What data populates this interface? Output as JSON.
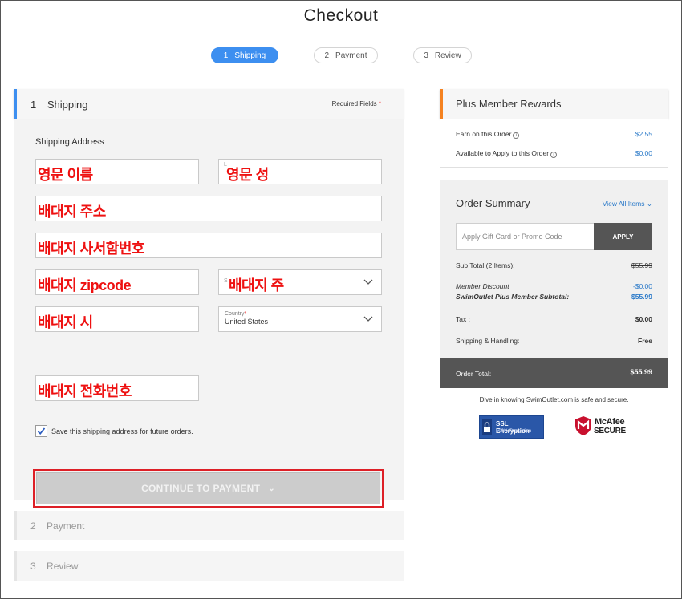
{
  "page": {
    "title": "Checkout"
  },
  "steps": [
    {
      "num": "1",
      "label": "Shipping",
      "active": true
    },
    {
      "num": "2",
      "label": "Payment",
      "active": false
    },
    {
      "num": "3",
      "label": "Review",
      "active": false
    }
  ],
  "shipping": {
    "num": "1",
    "title": "Shipping",
    "required_label": "Required Fields",
    "required_mark": "*",
    "address_label": "Shipping Address",
    "fields": {
      "first_name": "영문 이름",
      "last_name": "영문 성",
      "address": "배대지 주소",
      "address2": "배대지 사서함번호",
      "zipcode": "배대지 zipcode",
      "state": "배대지 주",
      "city": "배대지 시",
      "phone": "배대지 전화번호"
    },
    "country": {
      "label": "Country",
      "value": "United States"
    },
    "save_label": "Save this shipping address for future orders.",
    "save_checked": true,
    "continue_label": "CONTINUE TO PAYMENT"
  },
  "collapsed_sections": {
    "payment": {
      "num": "2",
      "title": "Payment"
    },
    "review": {
      "num": "3",
      "title": "Review"
    }
  },
  "rewards": {
    "title": "Plus Member Rewards",
    "earn_label": "Earn on this Order",
    "earn_value": "$2.55",
    "available_label": "Available to Apply to this Order",
    "available_value": "$0.00"
  },
  "summary": {
    "title": "Order Summary",
    "view_all": "View All Items",
    "promo_placeholder": "Apply Gift Card or Promo Code",
    "apply_label": "APPLY",
    "subtotal_label": "Sub Total (2 Items):",
    "subtotal_value": "$55.99",
    "discount_label": "Member Discount",
    "discount_value": "-$0.00",
    "member_subtotal_label": "SwimOutlet Plus Member Subtotal:",
    "member_subtotal_value": "$55.99",
    "tax_label": "Tax :",
    "tax_value": "$0.00",
    "shipping_label": "Shipping & Handling:",
    "shipping_value": "Free",
    "total_label": "Order Total:",
    "total_value": "$55.99"
  },
  "security": {
    "text": "Dive in knowing SwimOutlet.com is safe and secure.",
    "ssl_title": "SSL Encryption",
    "ssl_sub": "100% Protection",
    "mcafee_a": "McAfee",
    "mcafee_b": "SECURE"
  },
  "colors": {
    "accent_blue": "#3d8ff0",
    "rewards_orange": "#f58220",
    "annotation_red": "#ee1111"
  }
}
